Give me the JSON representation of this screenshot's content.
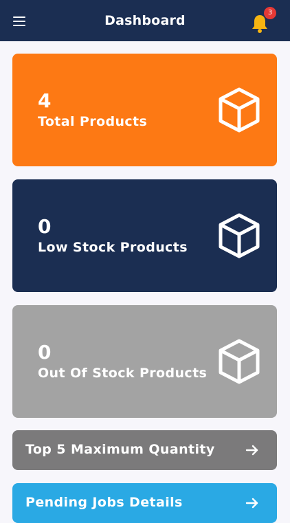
{
  "header": {
    "title": "Dashboard",
    "notification_count": "3",
    "icons": {
      "menu": "hamburger-icon",
      "notifications": "bell-icon"
    },
    "colors": {
      "background": "#1b2e52",
      "bell": "#f6b512",
      "badge": "#e53935"
    }
  },
  "cards": [
    {
      "count": "4",
      "label": "Total Products",
      "icon": "cube-icon",
      "color": "#fd7914"
    },
    {
      "count": "0",
      "label": "Low Stock Products",
      "icon": "cube-icon",
      "color": "#1b2e52"
    },
    {
      "count": "0",
      "label": "Out Of Stock Products",
      "icon": "cube-icon",
      "color": "#a3a3a3"
    }
  ],
  "links": [
    {
      "label": "Top 5 Maximum Quantity",
      "icon": "arrow-right-icon",
      "color": "#7b7a7b"
    },
    {
      "label": "Pending Jobs Details",
      "icon": "arrow-right-icon",
      "color": "#2aa9e4"
    }
  ]
}
